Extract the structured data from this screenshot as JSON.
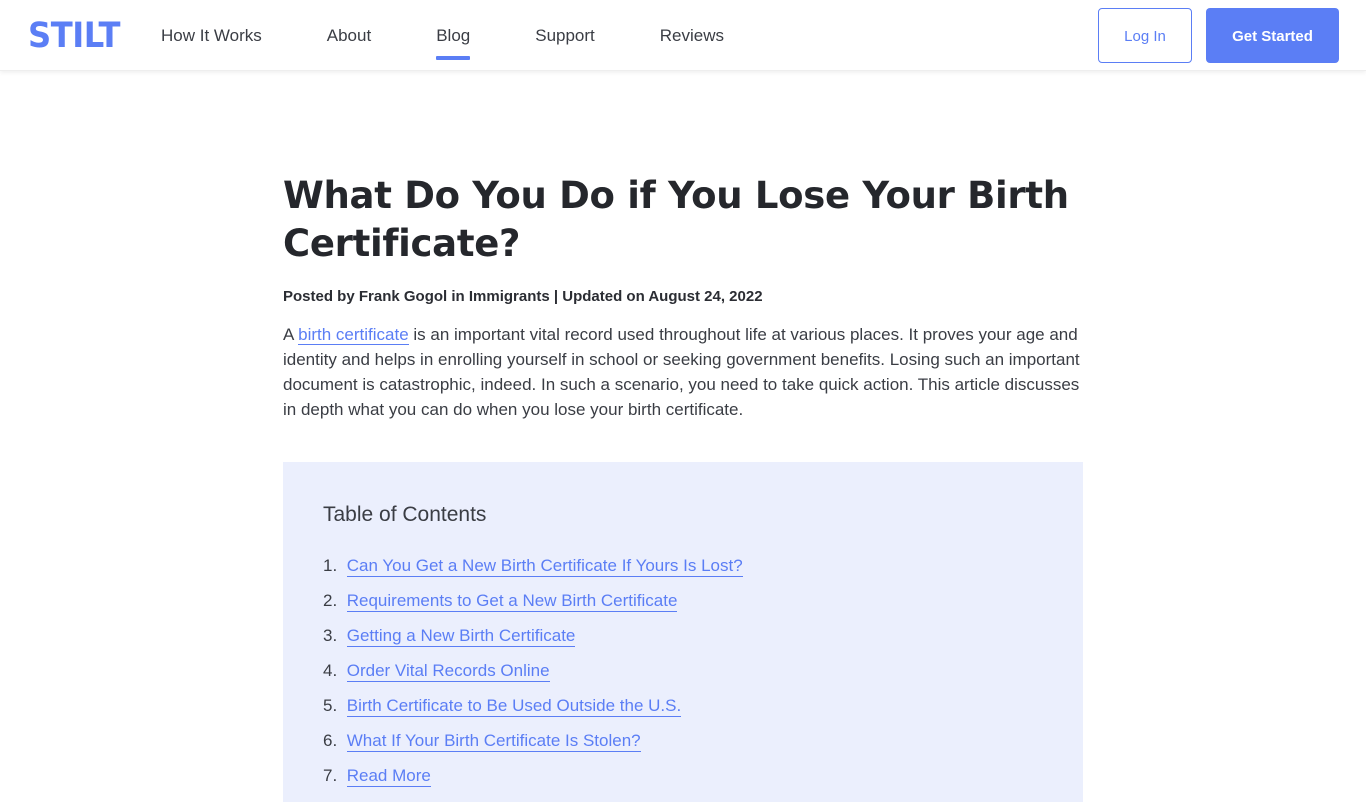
{
  "header": {
    "logo": "STILT",
    "nav": [
      {
        "label": "How It Works",
        "active": false
      },
      {
        "label": "About",
        "active": false
      },
      {
        "label": "Blog",
        "active": true
      },
      {
        "label": "Support",
        "active": false
      },
      {
        "label": "Reviews",
        "active": false
      }
    ],
    "login_label": "Log In",
    "get_started_label": "Get Started"
  },
  "article": {
    "title": "What Do You Do if You Lose Your Birth Certificate?",
    "byline": "Posted by Frank Gogol in Immigrants | Updated on August 24, 2022",
    "intro": {
      "prefix": "A ",
      "link_text": "birth certificate",
      "suffix": " is an important vital record used throughout life at various places. It proves your age and identity and helps in enrolling yourself in school or seeking government benefits. Losing such an important document is catastrophic, indeed. In such a scenario, you need to take quick action. This article discusses in depth what you can do when you lose your birth certificate."
    }
  },
  "toc": {
    "title": "Table of Contents",
    "items": [
      {
        "num": "1.",
        "label": "Can You Get a New Birth Certificate If Yours Is Lost?"
      },
      {
        "num": "2.",
        "label": "Requirements to Get a New Birth Certificate"
      },
      {
        "num": "3.",
        "label": "Getting a New Birth Certificate"
      },
      {
        "num": "4.",
        "label": "Order Vital Records Online"
      },
      {
        "num": "5.",
        "label": "Birth Certificate to Be Used Outside the U.S."
      },
      {
        "num": "6.",
        "label": "What If Your Birth Certificate Is Stolen?"
      },
      {
        "num": "7.",
        "label": "Read More"
      }
    ]
  },
  "colors": {
    "brand": "#5b7ef5",
    "toc_background": "#ebeffd",
    "text": "#2b2d33"
  }
}
